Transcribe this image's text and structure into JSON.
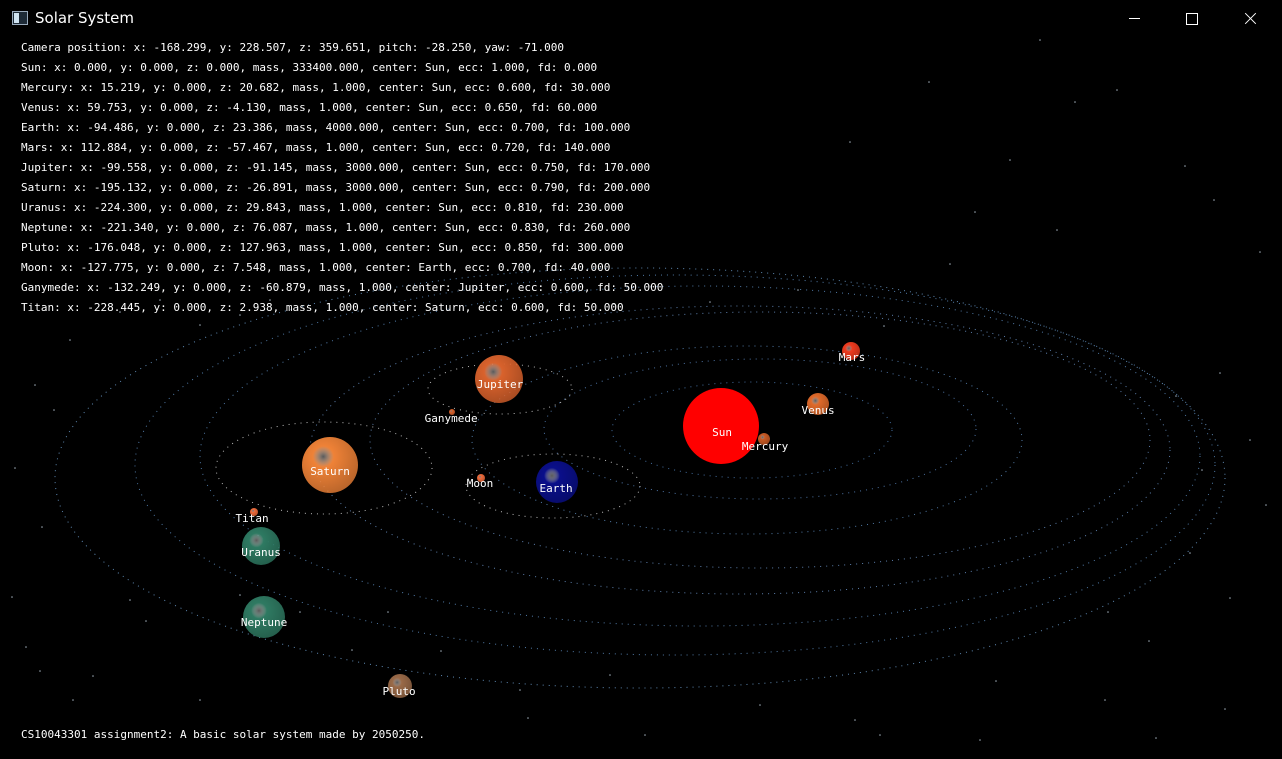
{
  "window": {
    "title": "Solar System"
  },
  "info_lines": [
    "Camera position: x: -168.299, y: 228.507, z: 359.651, pitch: -28.250, yaw: -71.000",
    "Sun: x: 0.000, y: 0.000, z: 0.000, mass, 333400.000, center: Sun, ecc: 1.000, fd: 0.000",
    "Mercury: x: 15.219, y: 0.000, z: 20.682, mass, 1.000, center: Sun, ecc: 0.600, fd: 30.000",
    "Venus: x: 59.753, y: 0.000, z: -4.130, mass, 1.000, center: Sun, ecc: 0.650, fd: 60.000",
    "Earth: x: -94.486, y: 0.000, z: 23.386, mass, 4000.000, center: Sun, ecc: 0.700, fd: 100.000",
    "Mars: x: 112.884, y: 0.000, z: -57.467, mass, 1.000, center: Sun, ecc: 0.720, fd: 140.000",
    "Jupiter: x: -99.558, y: 0.000, z: -91.145, mass, 3000.000, center: Sun, ecc: 0.750, fd: 170.000",
    "Saturn: x: -195.132, y: 0.000, z: -26.891, mass, 3000.000, center: Sun, ecc: 0.790, fd: 200.000",
    "Uranus: x: -224.300, y: 0.000, z: 29.843, mass, 1.000, center: Sun, ecc: 0.810, fd: 230.000",
    "Neptune: x: -221.340, y: 0.000, z: 76.087, mass, 1.000, center: Sun, ecc: 0.830, fd: 260.000",
    "Pluto: x: -176.048, y: 0.000, z: 127.963, mass, 1.000, center: Sun, ecc: 0.850, fd: 300.000",
    "Moon: x: -127.775, y: 0.000, z: 7.548, mass, 1.000, center: Earth, ecc: 0.700, fd: 40.000",
    "Ganymede: x: -132.249, y: 0.000, z: -60.879, mass, 1.000, center: Jupiter, ecc: 0.600, fd: 50.000",
    "Titan: x: -228.445, y: 0.000, z: 2.938, mass, 1.000, center: Saturn, ecc: 0.600, fd: 50.000"
  ],
  "bodies": [
    {
      "name": "Sun",
      "color": "#ff0000"
    },
    {
      "name": "Mercury",
      "color": "#c85a24"
    },
    {
      "name": "Venus",
      "color": "#e06a2a"
    },
    {
      "name": "Earth",
      "color": "#0a0f8a"
    },
    {
      "name": "Mars",
      "color": "#ee3b1f"
    },
    {
      "name": "Jupiter",
      "color": "#d9622c"
    },
    {
      "name": "Saturn",
      "color": "#ef8237"
    },
    {
      "name": "Uranus",
      "color": "#2e7a62"
    },
    {
      "name": "Neptune",
      "color": "#2f7a62"
    },
    {
      "name": "Pluto",
      "color": "#9a6a48"
    },
    {
      "name": "Moon",
      "color": "#ee6a3a"
    },
    {
      "name": "Ganymede",
      "color": "#d9622c"
    },
    {
      "name": "Titan",
      "color": "#ee6a3a"
    }
  ],
  "footer": "CS10043301 assignment2: A basic solar system made by 2050250."
}
